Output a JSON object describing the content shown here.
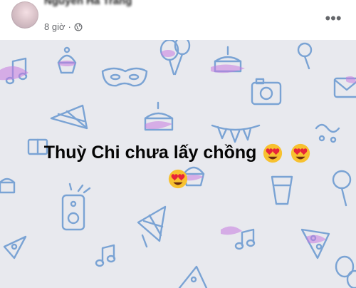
{
  "post": {
    "author": "Nguyễn Hà Trang",
    "timestamp": "8 giờ",
    "privacy_icon": "globe-icon",
    "more_label": "•••",
    "text": "Thuỳ Chi chưa lấy chồng",
    "emoji_icon": "heart-eyes-emoji-icon",
    "background_color": "#e8e9ee",
    "pattern_color": "#7aa3d4",
    "highlight_color": "#c77be0"
  }
}
